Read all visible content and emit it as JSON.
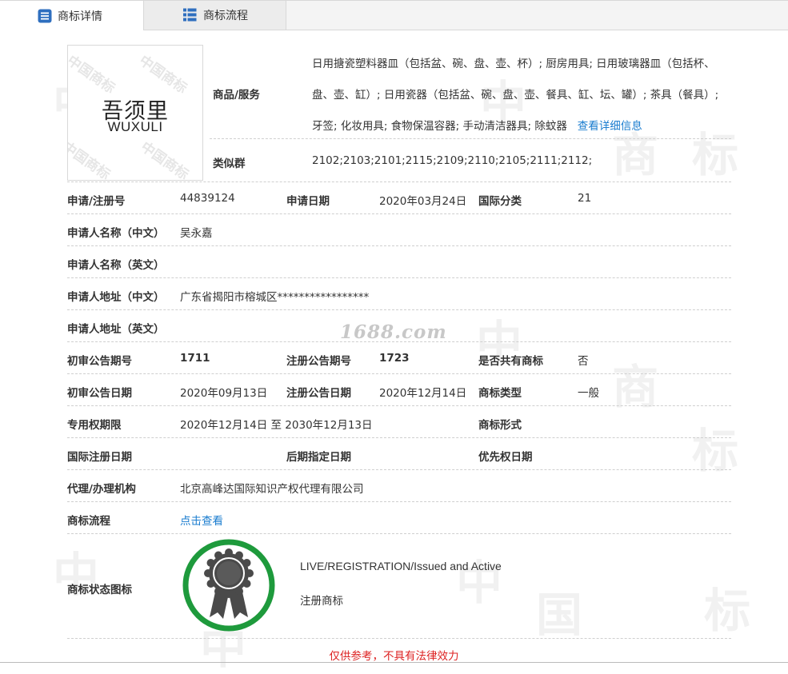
{
  "tabs": [
    {
      "label": "商标详情",
      "icon": "document-list-icon",
      "active": true
    },
    {
      "label": "商标流程",
      "icon": "grid-list-icon",
      "active": false
    }
  ],
  "watermark": {
    "site": "1688.com",
    "chars": [
      "中",
      "国",
      "商",
      "标"
    ]
  },
  "trademark_image": {
    "chinese": "吾须里",
    "english": "WUXULI",
    "watermark_text": "中国商标"
  },
  "goods_services": {
    "label": "商品/服务",
    "lines": [
      "日用搪瓷塑料器皿（包括盆、碗、盘、壶、杯）; 厨房用具; 日用玻璃器皿（包括杯、",
      "盘、壶、缸）; 日用瓷器（包括盆、碗、盘、壶、餐具、缸、坛、罐）; 茶具（餐具）;",
      "牙签; 化妆用具; 食物保温容器; 手动清洁器具; 除蚊器"
    ],
    "detail_link": "查看详细信息"
  },
  "similar_groups": {
    "label": "类似群",
    "value": "2102;2103;2101;2115;2109;2110;2105;2111;2112;"
  },
  "fields": {
    "reg_no_label": "申请/注册号",
    "reg_no": "44839124",
    "apply_date_label": "申请日期",
    "apply_date": "2020年03月24日",
    "intl_class_label": "国际分类",
    "intl_class": "21",
    "applicant_cn_label": "申请人名称（中文）",
    "applicant_cn": "吴永嘉",
    "applicant_en_label": "申请人名称（英文）",
    "applicant_en": "",
    "address_cn_label": "申请人地址（中文）",
    "address_cn": "广东省揭阳市榕城区*****************",
    "address_en_label": "申请人地址（英文）",
    "address_en": "",
    "prelim_issue_label": "初审公告期号",
    "prelim_issue": "1711",
    "reg_issue_label": "注册公告期号",
    "reg_issue": "1723",
    "shared_label": "是否共有商标",
    "shared": "否",
    "prelim_date_label": "初审公告日期",
    "prelim_date": "2020年09月13日",
    "reg_date_label": "注册公告日期",
    "reg_date": "2020年12月14日",
    "tm_type_label": "商标类型",
    "tm_type": "一般",
    "exclusive_label": "专用权期限",
    "exclusive": "2020年12月14日 至 2030年12月13日",
    "tm_form_label": "商标形式",
    "tm_form": "",
    "intl_reg_date_label": "国际注册日期",
    "intl_reg_date": "",
    "later_date_label": "后期指定日期",
    "later_date": "",
    "priority_date_label": "优先权日期",
    "priority_date": "",
    "agency_label": "代理/办理机构",
    "agency": "北京高峰达国际知识产权代理有限公司",
    "process_label": "商标流程",
    "process_link": "点击查看"
  },
  "status": {
    "label": "商标状态图标",
    "line1": "LIVE/REGISTRATION/Issued and Active",
    "line2": "注册商标",
    "ring_color": "#1e9a3c",
    "seal_color": "#4a4a4a"
  },
  "footer": {
    "note": "仅供参考，不具有法律效力",
    "note_color": "#dd2222"
  }
}
